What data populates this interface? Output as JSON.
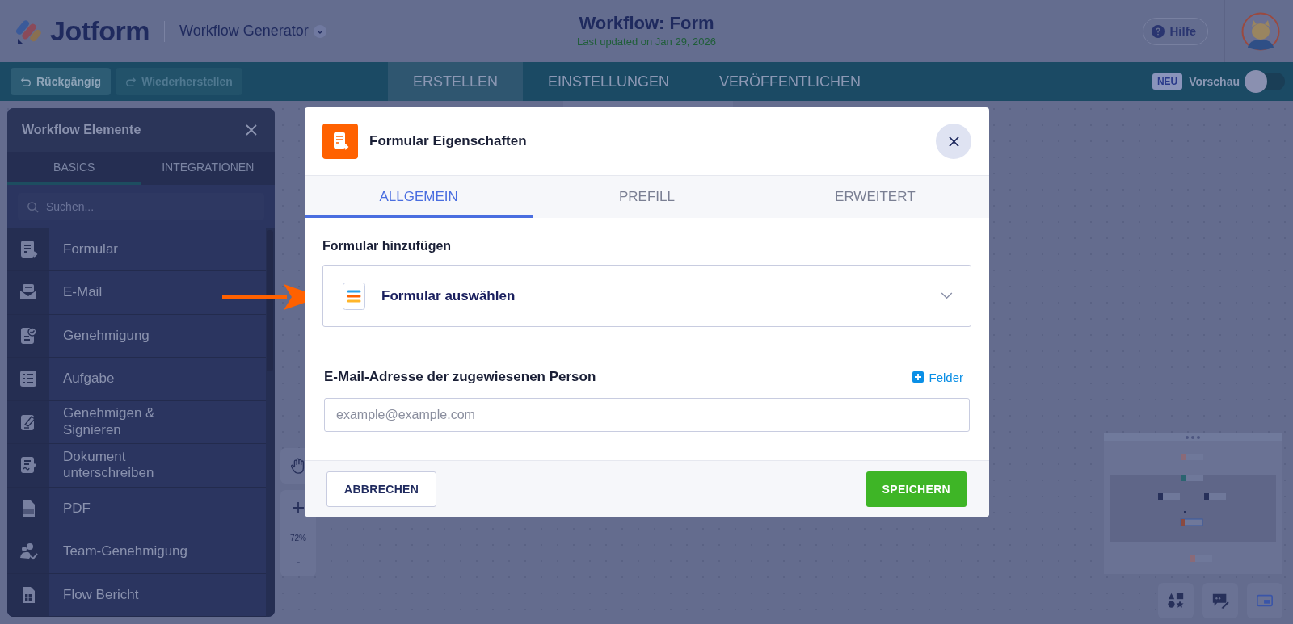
{
  "header": {
    "logo": "Jotform",
    "product": "Workflow Generator",
    "title": "Workflow: Form",
    "subtitle": "Last updated on Jan 29, 2026",
    "help": "Hilfe"
  },
  "toolbar": {
    "undo": {
      "label": "Rückgängig",
      "disabled": false
    },
    "redo": {
      "label": "Wiederherstellen",
      "disabled": true
    },
    "tabs": [
      {
        "label": "ERSTELLEN",
        "selected": true
      },
      {
        "label": "EINSTELLUNGEN",
        "selected": false
      },
      {
        "label": "VERÖFFENTLICHEN",
        "selected": false
      }
    ],
    "badge": "NEU",
    "preview": {
      "label": "Vorschau",
      "on": false
    }
  },
  "sidebar": {
    "title": "Workflow Elemente",
    "tabs": [
      {
        "label": "BASICS",
        "selected": true
      },
      {
        "label": "INTEGRATIONEN",
        "selected": false
      }
    ],
    "search": {
      "placeholder": "Suchen..."
    },
    "items": [
      {
        "label": "Formular"
      },
      {
        "label": "E-Mail"
      },
      {
        "label": "Genehmigung"
      },
      {
        "label": "Aufgabe"
      },
      {
        "label": "Genehmigen & Signieren"
      },
      {
        "label": "Dokument unterschreiben"
      },
      {
        "label": "PDF"
      },
      {
        "label": "Team-Genehmigung"
      },
      {
        "label": "Flow Bericht"
      }
    ]
  },
  "zoom": {
    "level_text": "72%"
  },
  "dialog": {
    "title": "Formular Eigenschaften",
    "tabs": [
      {
        "label": "ALLGEMEIN",
        "selected": true
      },
      {
        "label": "PREFILL",
        "selected": false
      },
      {
        "label": "ERWEITERT",
        "selected": false
      }
    ],
    "section_label": "Formular hinzufügen",
    "form_select": {
      "value": "Formular auswählen"
    },
    "email_label": "E-Mail-Adresse der zugewiesenen Person",
    "fields_link": "Felder",
    "email_field": {
      "placeholder": "example@example.com"
    },
    "cancel": "ABBRECHEN",
    "save": "SPEICHERN"
  }
}
